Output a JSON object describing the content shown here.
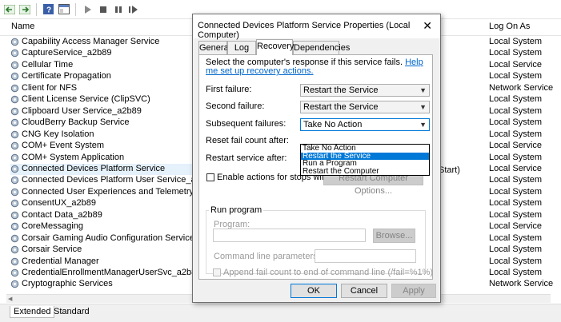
{
  "columns": {
    "name": "Name",
    "logon": "Log On As"
  },
  "services": [
    {
      "name": "Capability Access Manager Service",
      "logon": "Local System"
    },
    {
      "name": "CaptureService_a2b89",
      "logon": "Local System"
    },
    {
      "name": "Cellular Time",
      "logon": "Local Service"
    },
    {
      "name": "Certificate Propagation",
      "logon": "Local System"
    },
    {
      "name": "Client for NFS",
      "logon": "Network Service"
    },
    {
      "name": "Client License Service (ClipSVC)",
      "logon": "Local System"
    },
    {
      "name": "Clipboard User Service_a2b89",
      "logon": "Local System"
    },
    {
      "name": "CloudBerry Backup Service",
      "logon": "Local System"
    },
    {
      "name": "CNG Key Isolation",
      "logon": "Local System"
    },
    {
      "name": "COM+ Event System",
      "logon": "Local Service"
    },
    {
      "name": "COM+ System Application",
      "logon": "Local System"
    },
    {
      "name": "Connected Devices Platform Service",
      "logon": "Local Service",
      "extra": "Start)"
    },
    {
      "name": "Connected Devices Platform User Service_a2b89",
      "logon": "Local System"
    },
    {
      "name": "Connected User Experiences and Telemetry",
      "logon": "Local System"
    },
    {
      "name": "ConsentUX_a2b89",
      "logon": "Local System"
    },
    {
      "name": "Contact Data_a2b89",
      "logon": "Local System"
    },
    {
      "name": "CoreMessaging",
      "logon": "Local Service"
    },
    {
      "name": "Corsair Gaming Audio Configuration Service",
      "logon": "Local System"
    },
    {
      "name": "Corsair Service",
      "logon": "Local System"
    },
    {
      "name": "Credential Manager",
      "logon": "Local System"
    },
    {
      "name": "CredentialEnrollmentManagerUserSvc_a2b89",
      "logon": "Local System"
    },
    {
      "name": "Cryptographic Services",
      "logon": "Network Service"
    }
  ],
  "bottom_tabs": {
    "extended": "Extended",
    "standard": "Standard"
  },
  "dialog": {
    "title": "Connected Devices Platform Service Properties (Local Computer)",
    "close": "✕",
    "tabs": [
      "General",
      "Log On",
      "Recovery",
      "Dependencies"
    ],
    "intro": "Select the computer's response if this service fails.",
    "help_link": "Help me set up recovery actions.",
    "first_failure_label": "First failure:",
    "first_failure_value": "Restart the Service",
    "second_failure_label": "Second failure:",
    "second_failure_value": "Restart the Service",
    "subsequent_label": "Subsequent failures:",
    "subsequent_value": "Take No Action",
    "dropdown_options": [
      "Take No Action",
      "Restart the Service",
      "Run a Program",
      "Restart the Computer"
    ],
    "dropdown_selected_index": 1,
    "reset_label": "Reset fail count after:",
    "restart_label": "Restart service after:",
    "enable_stops_label": "Enable actions for stops with errors.",
    "restart_computer_btn": "Restart Computer Options...",
    "run_program_group": "Run program",
    "program_label": "Program:",
    "browse_btn": "Browse...",
    "cmd_params_label": "Command line parameters:",
    "append_label": "Append fail count to end of command line (/fail=%1%)",
    "ok": "OK",
    "cancel": "Cancel",
    "apply": "Apply"
  },
  "colors": {
    "accent": "#0078d7",
    "link": "#0066cc",
    "selected_row": "#e5f1fb"
  },
  "icons": [
    "back-arrow-icon",
    "forward-arrow-icon",
    "help-icon",
    "console-icon",
    "play-icon",
    "stop-icon",
    "pause-icon",
    "restart-icon",
    "gear-icon"
  ]
}
